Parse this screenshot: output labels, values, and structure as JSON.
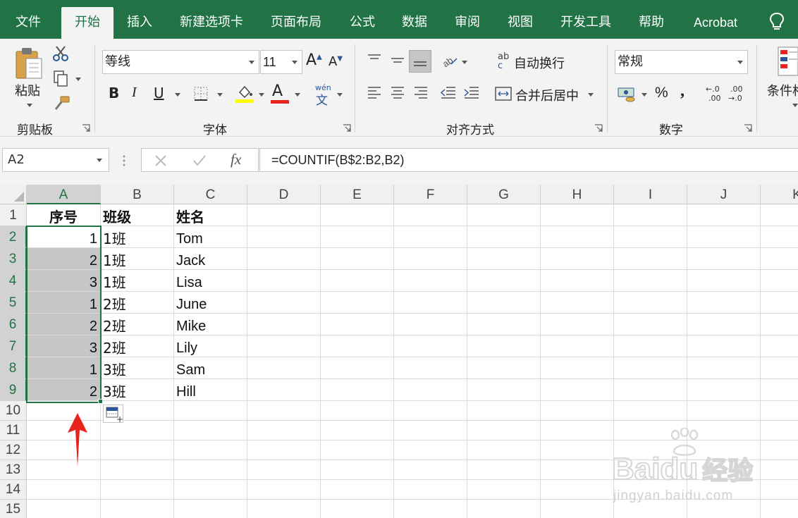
{
  "tabs": [
    {
      "label": "文件",
      "active": false
    },
    {
      "label": "开始",
      "active": true
    },
    {
      "label": "插入",
      "active": false
    },
    {
      "label": "新建选项卡",
      "active": false
    },
    {
      "label": "页面布局",
      "active": false
    },
    {
      "label": "公式",
      "active": false
    },
    {
      "label": "数据",
      "active": false
    },
    {
      "label": "审阅",
      "active": false
    },
    {
      "label": "视图",
      "active": false
    },
    {
      "label": "开发工具",
      "active": false
    },
    {
      "label": "帮助",
      "active": false
    },
    {
      "label": "Acrobat",
      "active": false
    }
  ],
  "ribbon": {
    "clipboard": {
      "paste_label": "粘贴",
      "group_label": "剪贴板"
    },
    "font": {
      "name": "等线",
      "size": "11",
      "bold": "B",
      "italic": "I",
      "underline": "U",
      "group_label": "字体",
      "grow_label": "A",
      "shrink_label": "A",
      "phonetic_top": "wén",
      "phonetic_bottom": "文",
      "font_color_glyph": "A"
    },
    "alignment": {
      "wrap_label": "自动换行",
      "wrap_icon_top": "ab",
      "wrap_icon_bottom": "c",
      "merge_label": "合并后居中",
      "group_label": "对齐方式"
    },
    "number": {
      "format": "常规",
      "percent": "%",
      "comma": ",",
      "inc_decimal_top": "←.0",
      "inc_decimal_bottom": ".00",
      "dec_decimal_top": ".00",
      "dec_decimal_bottom": "→.0",
      "group_label": "数字"
    },
    "styles": {
      "conditional_label": "条件格"
    }
  },
  "formula_bar": {
    "name_box": "A2",
    "formula": "=COUNTIF(B$2:B2,B2)",
    "fx_label": "fx"
  },
  "columns": [
    "A",
    "B",
    "C",
    "D",
    "E",
    "F",
    "G",
    "H",
    "I",
    "J",
    "K"
  ],
  "rows": [
    "1",
    "2",
    "3",
    "4",
    "5",
    "6",
    "7",
    "8",
    "9",
    "10",
    "11",
    "12",
    "13",
    "14",
    "15"
  ],
  "sheet": {
    "headers": [
      "序号",
      "班级",
      "姓名"
    ],
    "data": [
      {
        "seq": "1",
        "cls": "1班",
        "name": "Tom"
      },
      {
        "seq": "2",
        "cls": "1班",
        "name": "Jack"
      },
      {
        "seq": "3",
        "cls": "1班",
        "name": "Lisa"
      },
      {
        "seq": "1",
        "cls": "2班",
        "name": "June"
      },
      {
        "seq": "2",
        "cls": "2班",
        "name": "Mike"
      },
      {
        "seq": "3",
        "cls": "2班",
        "name": "Lily"
      },
      {
        "seq": "1",
        "cls": "3班",
        "name": "Sam"
      },
      {
        "seq": "2",
        "cls": "3班",
        "name": "Hill"
      }
    ]
  },
  "watermark": {
    "brand": "Baidu",
    "brand_cn": "经验",
    "url": "jingyan.baidu.com"
  },
  "colors": {
    "accent": "#217346",
    "annotation": "#e8231b",
    "highlight_fill": "#c6c6c6",
    "font_color_bar": "#e8231b",
    "fill_color_bar": "#ffff00"
  }
}
